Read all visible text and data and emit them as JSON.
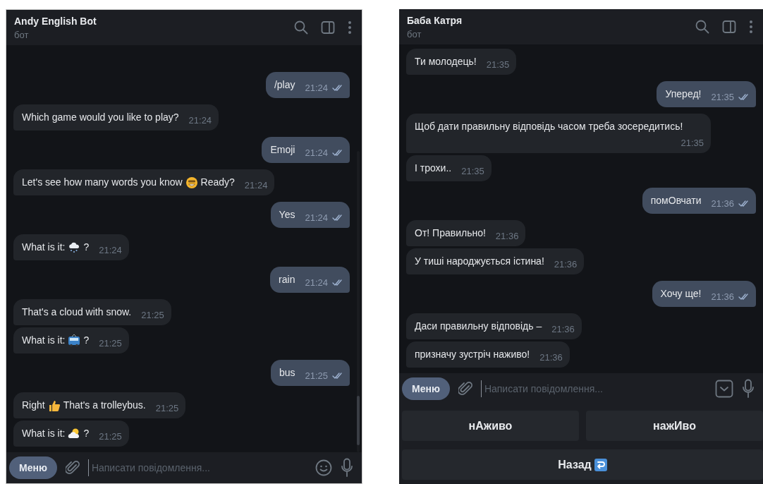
{
  "chats": [
    {
      "title": "Andy English Bot",
      "subtitle": "бот",
      "messages": [
        {
          "outgoing": true,
          "segments": [
            {
              "text": "/play"
            }
          ],
          "time": "21:24",
          "read": true
        },
        {
          "outgoing": false,
          "segments": [
            {
              "text": "Which game would you like to play?"
            }
          ],
          "time": "21:24"
        },
        {
          "outgoing": true,
          "segments": [
            {
              "text": "Emoji"
            }
          ],
          "time": "21:24",
          "read": true
        },
        {
          "outgoing": false,
          "segments": [
            {
              "text": "Let's see how many words you know"
            },
            {
              "kind": "grin"
            },
            {
              "text": "Ready?"
            }
          ],
          "time": "21:24"
        },
        {
          "outgoing": true,
          "segments": [
            {
              "text": "Yes"
            }
          ],
          "time": "21:24",
          "read": true
        },
        {
          "outgoing": false,
          "segments": [
            {
              "text": "What is it:"
            },
            {
              "kind": "snowcloud"
            },
            {
              "text": "?"
            }
          ],
          "time": "21:24"
        },
        {
          "outgoing": true,
          "segments": [
            {
              "text": "rain"
            }
          ],
          "time": "21:24",
          "read": true
        },
        {
          "outgoing": false,
          "segments": [
            {
              "text": "That's a cloud with snow."
            }
          ],
          "time": "21:25"
        },
        {
          "outgoing": false,
          "segments": [
            {
              "text": "What is it:"
            },
            {
              "kind": "trolleybus"
            },
            {
              "text": "?"
            }
          ],
          "time": "21:25"
        },
        {
          "outgoing": true,
          "segments": [
            {
              "text": "bus"
            }
          ],
          "time": "21:25",
          "read": true
        },
        {
          "outgoing": false,
          "segments": [
            {
              "text": "Right"
            },
            {
              "kind": "thumbsup"
            },
            {
              "text": "That's a trolleybus."
            }
          ],
          "time": "21:25"
        },
        {
          "outgoing": false,
          "segments": [
            {
              "text": "What is it:"
            },
            {
              "kind": "suncloud"
            },
            {
              "text": "?"
            }
          ],
          "time": "21:25"
        }
      ],
      "composer": {
        "menu": "Меню",
        "placeholder": "Написати повідомлення...",
        "action": {
          "kind": "emoji"
        }
      }
    },
    {
      "title": "Баба Катря",
      "subtitle": "бот",
      "messages": [
        {
          "outgoing": false,
          "segments": [
            {
              "text": "Ти молодець!"
            }
          ],
          "time": "21:35"
        },
        {
          "outgoing": true,
          "segments": [
            {
              "text": "Уперед!"
            }
          ],
          "time": "21:35",
          "read": true
        },
        {
          "outgoing": false,
          "segments": [
            {
              "text": "Щоб дати правильну відповідь часом треба зосередитись!"
            }
          ],
          "time": "21:35"
        },
        {
          "outgoing": false,
          "segments": [
            {
              "text": "І трохи.."
            }
          ],
          "time": "21:35"
        },
        {
          "outgoing": true,
          "segments": [
            {
              "text": "помОвчати"
            }
          ],
          "time": "21:36",
          "read": true
        },
        {
          "outgoing": false,
          "segments": [
            {
              "text": "От! Правильно!"
            }
          ],
          "time": "21:36"
        },
        {
          "outgoing": false,
          "segments": [
            {
              "text": "У тиші народжується істина!"
            }
          ],
          "time": "21:36"
        },
        {
          "outgoing": true,
          "segments": [
            {
              "text": "Хочу ще!"
            }
          ],
          "time": "21:36",
          "read": true
        },
        {
          "outgoing": false,
          "segments": [
            {
              "text": "Даси правильну відповідь –"
            }
          ],
          "time": "21:36"
        },
        {
          "outgoing": false,
          "segments": [
            {
              "text": "призначу зустріч наживо!"
            }
          ],
          "time": "21:36"
        }
      ],
      "composer": {
        "menu": "Меню",
        "placeholder": "Написати повідомлення...",
        "action": {
          "kind": "keyboard"
        }
      },
      "keyboard": [
        [
          {
            "label": "нАживо"
          },
          {
            "label": "нажИво"
          }
        ],
        [
          {
            "label": "Назад",
            "icon": {
              "kind": "returnarrow"
            }
          }
        ]
      ]
    }
  ]
}
